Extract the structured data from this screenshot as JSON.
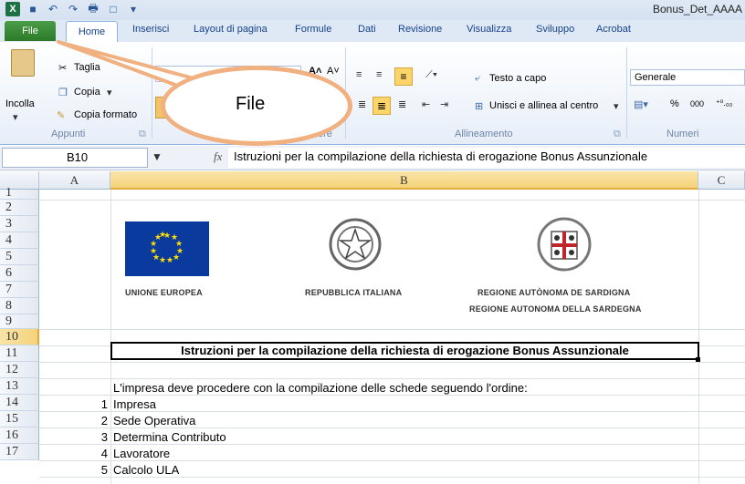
{
  "window": {
    "title": "Bonus_Det_AAAA"
  },
  "tabs": {
    "file": "File",
    "home": "Home",
    "inserisci": "Inserisci",
    "layout": "Layout di pagina",
    "formule": "Formule",
    "dati": "Dati",
    "revisione": "Revisione",
    "visualizza": "Visualizza",
    "sviluppo": "Sviluppo",
    "acrobat": "Acrobat"
  },
  "ribbon": {
    "clipboard": {
      "paste": "Incolla",
      "cut": "Taglia",
      "copy": "Copia",
      "copy_format": "Copia formato",
      "group": "Appunti"
    },
    "alignment": {
      "wrap": "Testo a capo",
      "merge": "Unisci e allinea al centro",
      "group": "Allineamento"
    },
    "number": {
      "format": "Generale",
      "percent": "%",
      "thousands": "000",
      "group": "Numeri"
    },
    "font_group": "Carattere"
  },
  "callout": {
    "text": "File"
  },
  "formula_bar": {
    "name_box": "B10",
    "fx": "fx",
    "content": "Istruzioni per la compilazione della richiesta di erogazione Bonus Assunzionale"
  },
  "columns": [
    "A",
    "B",
    "C"
  ],
  "rows": [
    "1",
    "2",
    "3",
    "4",
    "5",
    "6",
    "7",
    "8",
    "9",
    "10",
    "11",
    "12",
    "13",
    "14",
    "15",
    "16",
    "17"
  ],
  "logos": {
    "eu": "UNIONE EUROPEA",
    "it": "REPUBBLICA ITALIANA",
    "sard1": "REGIONE AUTÒNOMA DE SARDIGNA",
    "sard2": "REGIONE AUTONOMA DELLA SARDEGNA"
  },
  "sheet": {
    "title": "Istruzioni per la compilazione della richiesta di erogazione Bonus Assunzionale",
    "intro": "L'impresa deve procedere con la compilazione delle schede seguendo l'ordine:",
    "steps": [
      {
        "n": "1",
        "label": "Impresa"
      },
      {
        "n": "2",
        "label": "Sede Operativa"
      },
      {
        "n": "3",
        "label": "Determina Contributo"
      },
      {
        "n": "4",
        "label": "Lavoratore"
      },
      {
        "n": "5",
        "label": "Calcolo ULA"
      }
    ]
  },
  "colors": {
    "file_tab": "#2c7a2a",
    "callout_border": "#f0b080",
    "selected_col": "#f5d37a"
  }
}
